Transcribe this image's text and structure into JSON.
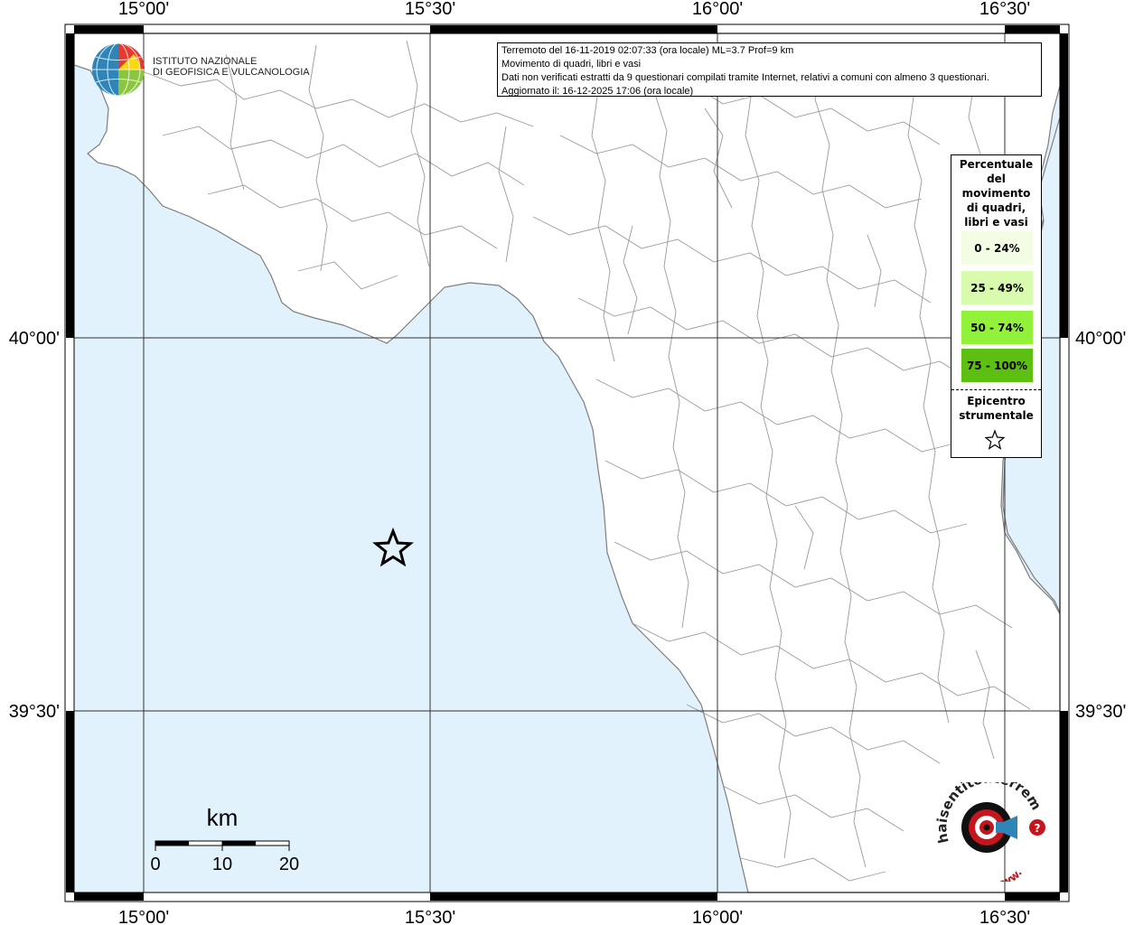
{
  "header": {
    "line1": "Terremoto del 16-11-2019 02:07:33 (ora locale) ML=3.7 Prof=9 km",
    "line2": "Movimento di quadri, libri e vasi",
    "line3": "Dati non verificati estratti da 9 questionari compilati tramite Internet, relativi a comuni con almeno 3 questionari.",
    "line4": "Aggiornato il: 16-12-2025 17:06 (ora locale)"
  },
  "coords": {
    "lon_top": [
      "15°00'",
      "15°30'",
      "16°00'",
      "16°30'"
    ],
    "lon_bottom": [
      "15°00'",
      "15°30'",
      "16°00'",
      "16°30'"
    ],
    "lat_left": [
      "40°00'",
      "39°30'"
    ],
    "lat_right": [
      "40°00'",
      "39°30'"
    ]
  },
  "legend": {
    "title_lines": [
      "Percentuale",
      "del",
      "movimento",
      "di quadri,",
      "libri e vasi"
    ],
    "classes": [
      {
        "label": "0 - 24%",
        "color": "#f3fde4"
      },
      {
        "label": "25 - 49%",
        "color": "#d9fbad"
      },
      {
        "label": "50 - 74%",
        "color": "#92f23a"
      },
      {
        "label": "75 - 100%",
        "color": "#5cbf12"
      }
    ],
    "epicenter_lines": [
      "Epicentro",
      "strumentale"
    ]
  },
  "scalebar": {
    "unit": "km",
    "ticks": [
      "0",
      "10",
      "20"
    ]
  },
  "logos": {
    "ingv_line1": "ISTITUTO NAZIONALE",
    "ingv_line2": "DI GEOFISICA E VULCANOLOGIA",
    "hsit_text": "haisentitoilterremoto.it",
    "hsit_www": "www."
  },
  "colors": {
    "sea": "#e2f2fc",
    "land": "#ffffff",
    "boundary": "#9a9a9a",
    "grid": "#333333"
  }
}
